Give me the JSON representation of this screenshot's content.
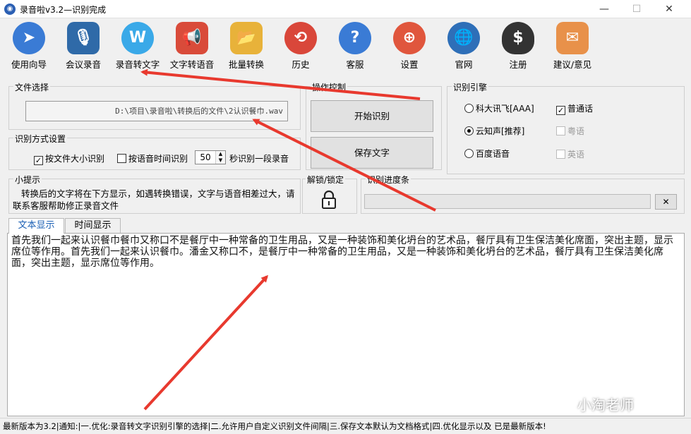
{
  "window": {
    "title": "录音啦v3.2—识别完成",
    "min_glyph": "—",
    "max_glyph": "☐",
    "close_glyph": "✕"
  },
  "toolbar": [
    {
      "label": "使用向导",
      "icon": "navigation-arrow-icon",
      "color": "#3a7bd5",
      "glyph": "➤"
    },
    {
      "label": "会议录音",
      "icon": "microphone-icon",
      "color": "#2f6aa8",
      "glyph": "🎙"
    },
    {
      "label": "录音转文字",
      "icon": "w-text-icon",
      "color": "#3aa9e8",
      "glyph": "W"
    },
    {
      "label": "文字转语音",
      "icon": "megaphone-icon",
      "color": "#d94b3a",
      "glyph": "📢"
    },
    {
      "label": "批量转换",
      "icon": "folder-convert-icon",
      "color": "#e8b23a",
      "glyph": "📂"
    },
    {
      "label": "历史",
      "icon": "history-clock-icon",
      "color": "#d9473a",
      "glyph": "⟲"
    },
    {
      "label": "客服",
      "icon": "help-question-icon",
      "color": "#3a7bd5",
      "glyph": "?"
    },
    {
      "label": "设置",
      "icon": "lifebuoy-icon",
      "color": "#e0563d",
      "glyph": "⊕"
    },
    {
      "label": "官网",
      "icon": "globe-icon",
      "color": "#2e6fb8",
      "glyph": "🌐"
    },
    {
      "label": "注册",
      "icon": "money-bag-icon",
      "color": "#333333",
      "glyph": "$"
    },
    {
      "label": "建议/意见",
      "icon": "cat-mailbox-icon",
      "color": "#e8914a",
      "glyph": "✉"
    }
  ],
  "file_select": {
    "title": "文件选择",
    "path": "D:\\项目\\录音啦\\转换后的文件\\2认识餐巾.wav"
  },
  "recognition_mode": {
    "title": "识别方式设置",
    "by_size": {
      "label": "按文件大小识别",
      "checked": true
    },
    "by_time": {
      "label": "按语音时间识别",
      "checked": false
    },
    "seconds_value": "50",
    "seconds_suffix": "秒识别一段录音"
  },
  "operation": {
    "title": "操作控制",
    "start_button": "开始识别",
    "save_button": "保存文字"
  },
  "engine": {
    "title": "识别引擎",
    "options": [
      {
        "label": "科大讯飞[AAA]",
        "selected": false
      },
      {
        "label": "云知声[推荐]",
        "selected": true
      },
      {
        "label": "百度语音",
        "selected": false
      }
    ],
    "languages": [
      {
        "label": "普通话",
        "checked": true,
        "enabled": true
      },
      {
        "label": "粤语",
        "checked": false,
        "enabled": false
      },
      {
        "label": "英语",
        "checked": false,
        "enabled": false
      }
    ]
  },
  "tips": {
    "title": "小提示",
    "text": "转换后的文字将在下方显示，如遇转换错误，文字与语音相差过大，请联系客服帮助修正录音文件"
  },
  "lock": {
    "title": "解锁/锁定",
    "icon": "padlock-icon"
  },
  "progress": {
    "title": "识别进度条",
    "value": 0,
    "clear_label": "✕"
  },
  "tabs": [
    {
      "label": "文本显示",
      "active": true
    },
    {
      "label": "时间显示",
      "active": false
    }
  ],
  "result_text": "首先我们一起来认识餐巾餐巾又称口不是餐厅中一种常备的卫生用品，又是一种装饰和美化坍台的艺术品，餐厅具有卫生保洁美化席面，突出主题，显示席位等作用。首先我们一起来认识餐巾。潘金又称口不，是餐厅中一种常备的卫生用品，又是一种装饰和美化坍台的艺术品，餐厅具有卫生保洁美化席面，突出主题，显示席位等作用。",
  "status_bar": "最新版本为3.2|通知:|一.优化:录音转文字识别引擎的选择|二.允许用户自定义识别文件间隔|三.保存文本默认为文档格式|四.优化显示以及 已是最新版本!",
  "watermark": "小淘老师"
}
